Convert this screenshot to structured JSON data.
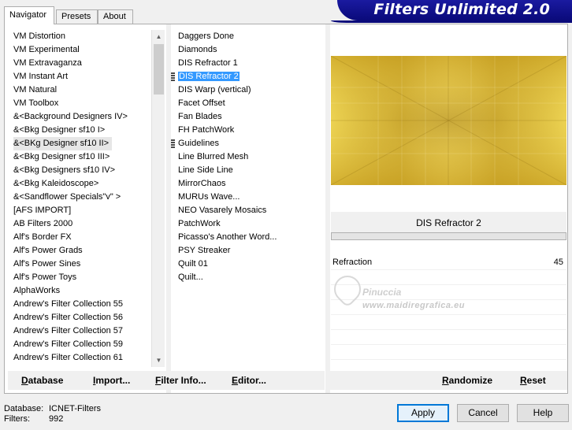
{
  "tabs": [
    "Navigator",
    "Presets",
    "About"
  ],
  "banner": "Filters Unlimited 2.0",
  "categories": [
    "VM Distortion",
    "VM Experimental",
    "VM Extravaganza",
    "VM Instant Art",
    "VM Natural",
    "VM Toolbox",
    "&<Background Designers IV>",
    "&<Bkg Designer sf10 I>",
    "&<BKg Designer sf10 II>",
    "&<Bkg Designer sf10 III>",
    "&<Bkg Designers sf10 IV>",
    "&<Bkg Kaleidoscope>",
    "&<Sandflower Specials\"v\" >",
    "[AFS IMPORT]",
    "AB Filters 2000",
    "Alf's Border FX",
    "Alf's Power Grads",
    "Alf's Power Sines",
    "Alf's Power Toys",
    "AlphaWorks",
    "Andrew's Filter Collection 55",
    "Andrew's Filter Collection 56",
    "Andrew's Filter Collection 57",
    "Andrew's Filter Collection 59",
    "Andrew's Filter Collection 61"
  ],
  "filters": [
    "Daggers Done",
    "Diamonds",
    "DIS Refractor 1",
    "DIS Refractor 2",
    "DIS Warp (vertical)",
    "Facet Offset",
    "Fan Blades",
    "FH PatchWork",
    "Guidelines",
    "Line Blurred Mesh",
    "Line Side Line",
    "MirrorChaos",
    "MURUs Wave...",
    "NEO Vasarely Mosaics",
    "PatchWork",
    "Picasso's Another Word...",
    "PSY Streaker",
    "Quilt 01",
    "Quilt..."
  ],
  "selected_filter": "DIS Refractor 2",
  "param": {
    "label": "Refraction",
    "value": "45"
  },
  "toolbar": {
    "database": "Database",
    "import": "Import...",
    "filter_info": "Filter Info...",
    "editor": "Editor...",
    "randomize": "Randomize",
    "reset": "Reset"
  },
  "status": {
    "database_label": "Database:",
    "database_value": "ICNET-Filters",
    "filters_label": "Filters:",
    "filters_value": "992"
  },
  "buttons": {
    "apply": "Apply",
    "cancel": "Cancel",
    "help": "Help"
  },
  "watermark": {
    "name": "Pinuccia",
    "url": "www.maidiregrafica.eu"
  },
  "colors": {
    "selection": "#3399ff",
    "banner": "#0a0a7a",
    "preview_gold": "#d4b02a"
  }
}
